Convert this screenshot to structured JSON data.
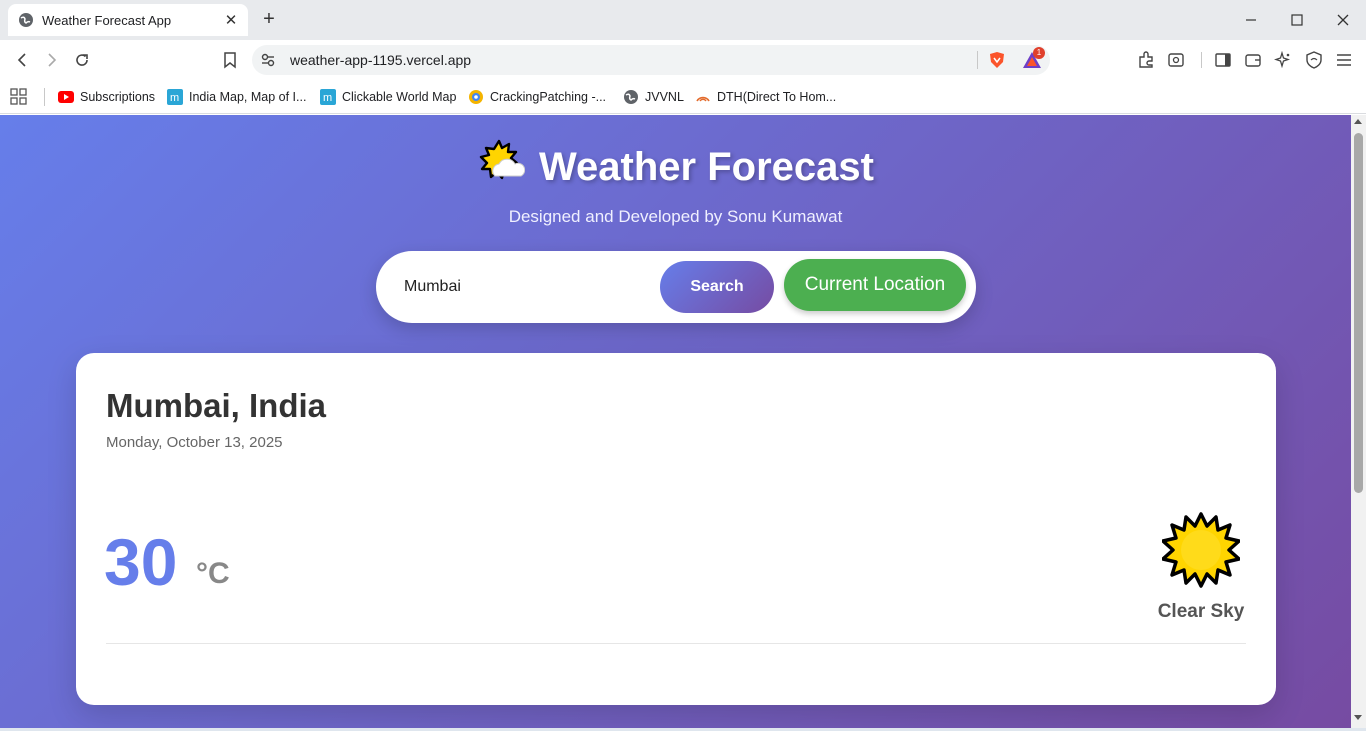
{
  "browser": {
    "tab_title": "Weather Forecast App",
    "tab_close": "✕",
    "new_tab": "+",
    "url": "weather-app-1195.vercel.app",
    "rewards_badge": "1"
  },
  "bookmarks": [
    {
      "label": "Subscriptions",
      "icon": "youtube-icon"
    },
    {
      "label": "India Map, Map of I...",
      "icon": "mapsofindia-icon"
    },
    {
      "label": "Clickable World Map",
      "icon": "mapsofworld-icon"
    },
    {
      "label": "CrackingPatching -...",
      "icon": "crackingpatching-icon"
    },
    {
      "label": "JVVNL",
      "icon": "globe-icon"
    },
    {
      "label": "DTH(Direct To Hom...",
      "icon": "dth-icon"
    }
  ],
  "app": {
    "title": "Weather Forecast",
    "subtitle": "Designed and Developed by Sonu Kumawat",
    "search": {
      "value": "Mumbai",
      "button": "Search"
    },
    "current_location_button": "Current Location",
    "weather": {
      "city": "Mumbai, India",
      "date": "Monday, October 13, 2025",
      "temperature": "30",
      "unit": "°C",
      "condition": "Clear Sky",
      "icon": "sun-icon"
    }
  },
  "colors": {
    "gradient_start": "#667eea",
    "gradient_end": "#764ba2",
    "location_button": "#4caf50"
  }
}
